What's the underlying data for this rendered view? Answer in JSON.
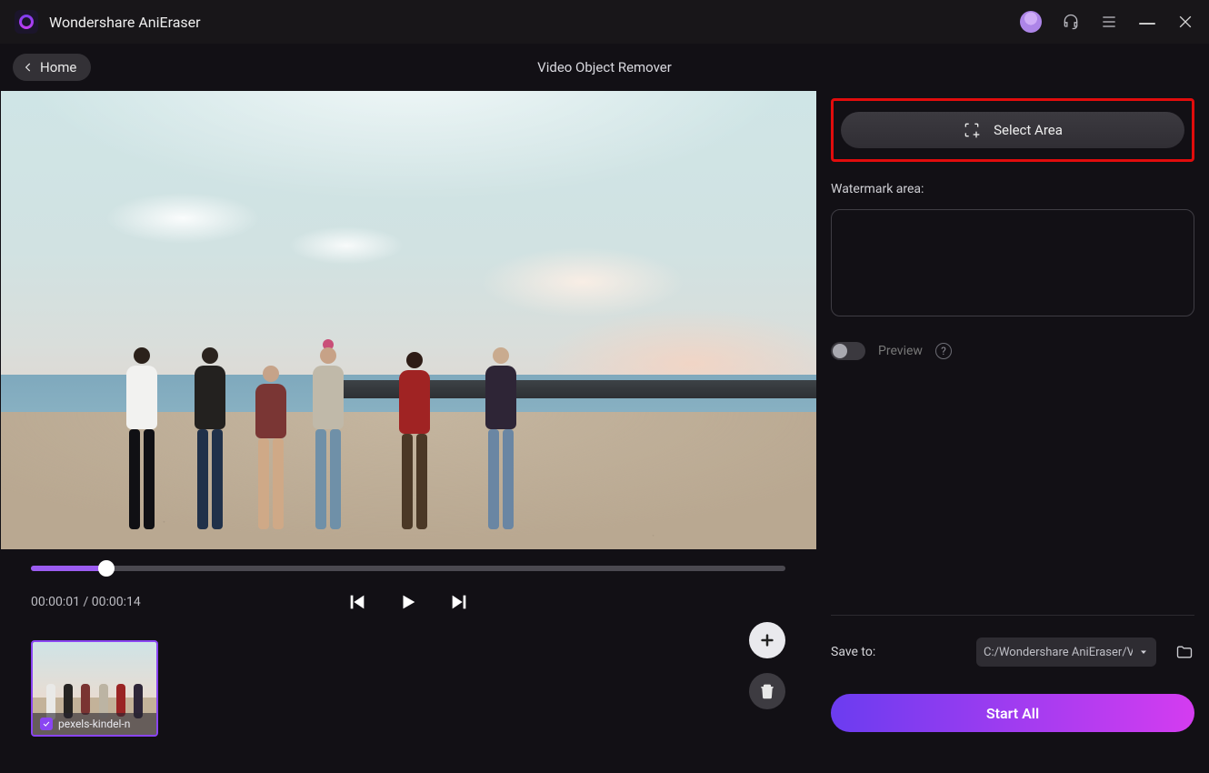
{
  "app": {
    "title": "Wondershare AniEraser"
  },
  "header": {
    "home_label": "Home",
    "page_title": "Video Object Remover"
  },
  "playback": {
    "current_time": "00:00:01",
    "total_time": "00:00:14",
    "time_display": "00:00:01 / 00:00:14",
    "progress_pct": 10
  },
  "thumbnails": [
    {
      "filename": "pexels-kindel-n",
      "checked": true
    }
  ],
  "sidebar": {
    "select_area_label": "Select Area",
    "watermark_label": "Watermark area:",
    "preview_label": "Preview",
    "preview_on": false,
    "save_to_label": "Save to:",
    "save_path": "C:/Wondershare AniEraser/V",
    "start_label": "Start All"
  }
}
